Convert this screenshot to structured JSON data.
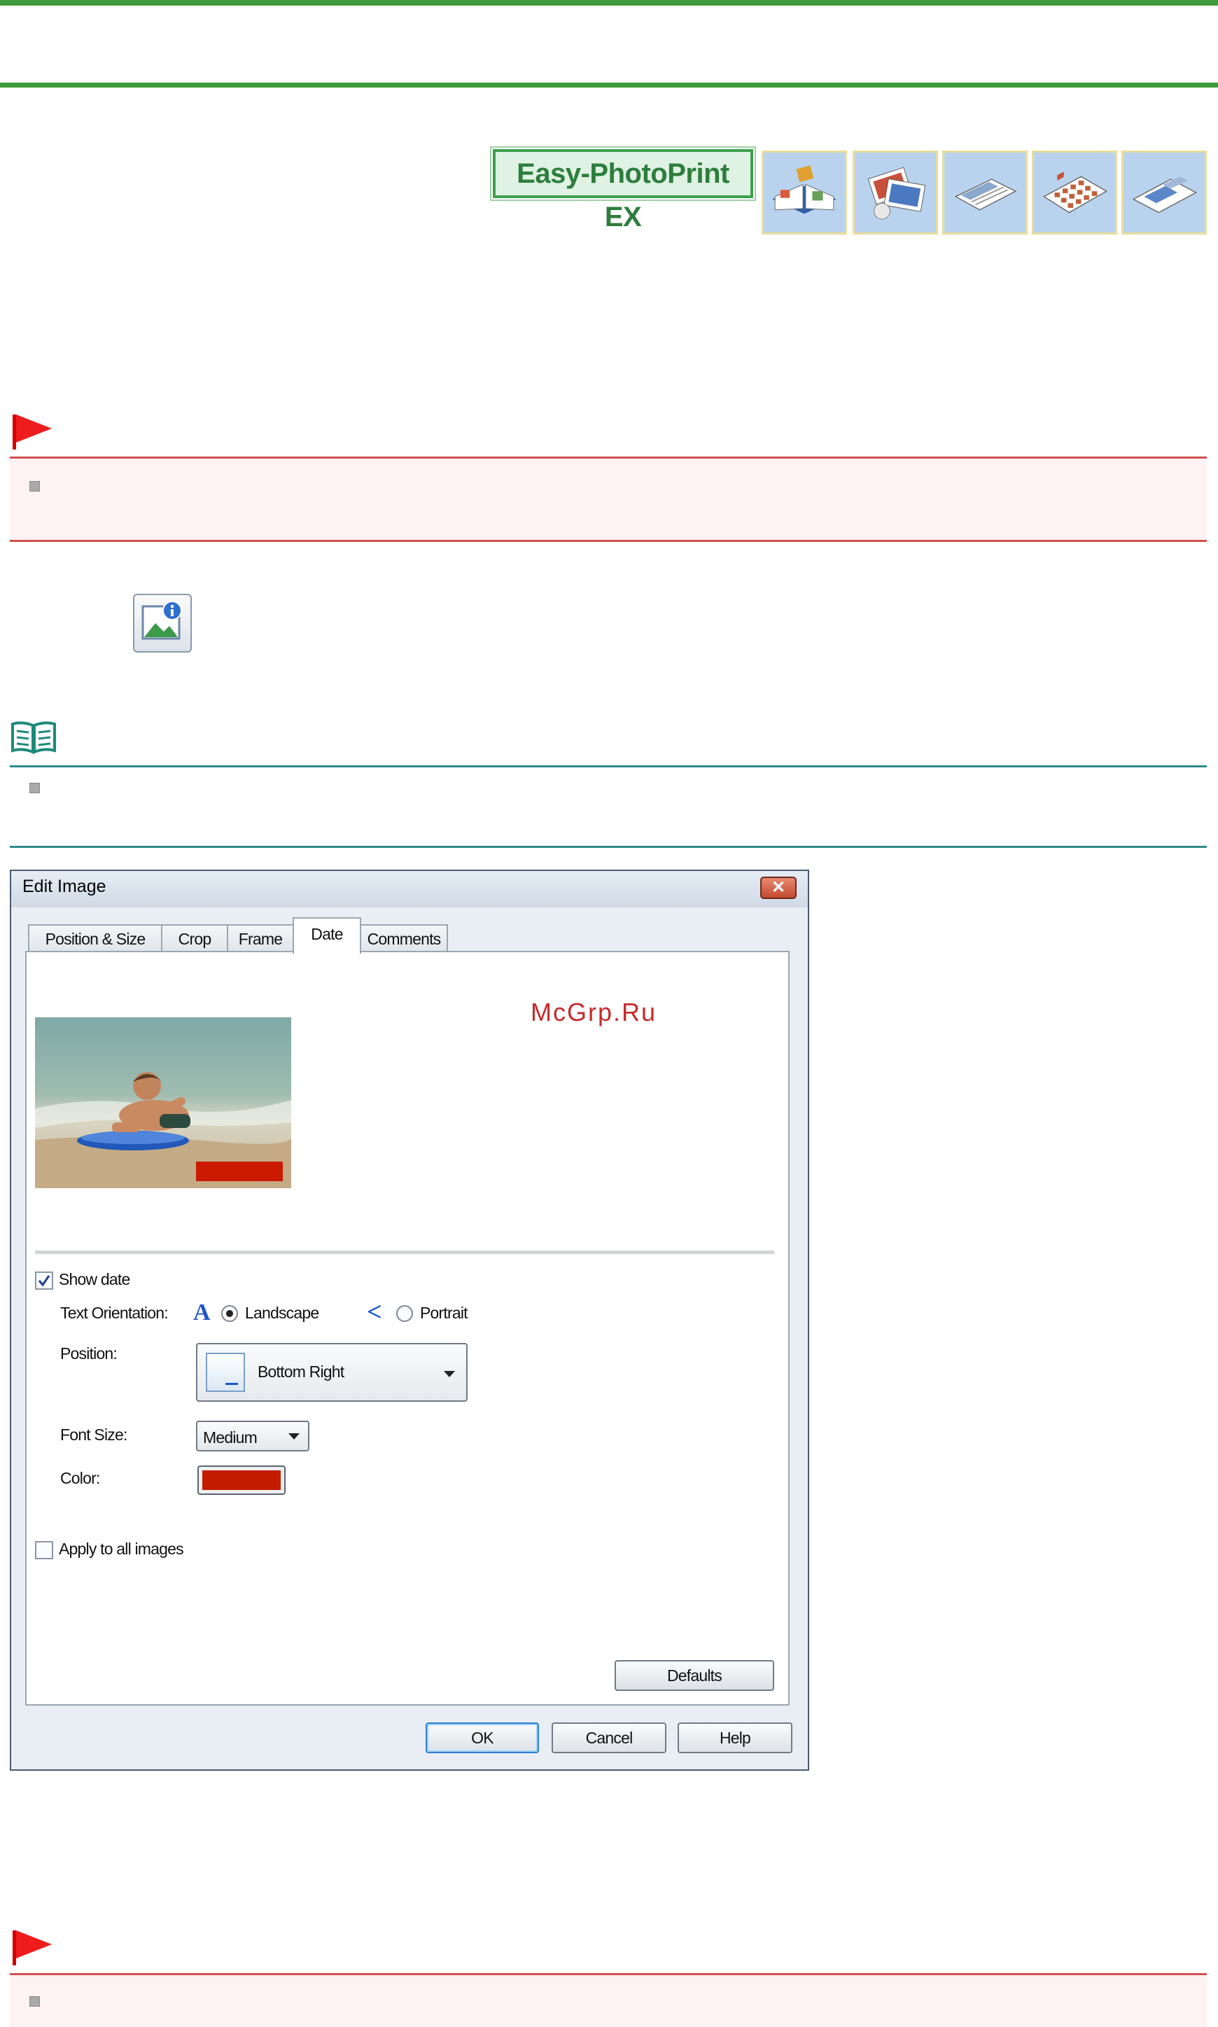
{
  "product": {
    "logo_text": "Easy-PhotoPrint EX"
  },
  "watermark": "McGrp.Ru",
  "dialog": {
    "title": "Edit Image",
    "close_symbol": "✕",
    "tabs": [
      {
        "label": "Position & Size"
      },
      {
        "label": "Crop"
      },
      {
        "label": "Frame"
      },
      {
        "label": "Date"
      },
      {
        "label": "Comments"
      }
    ],
    "active_tab": "Date",
    "show_date": {
      "label": "Show date",
      "checked": true
    },
    "text_orientation": {
      "label": "Text Orientation:",
      "landscape_label": "Landscape",
      "portrait_label": "Portrait",
      "landscape_glyph": "A",
      "portrait_glyph": "<",
      "selected": "Landscape"
    },
    "position": {
      "label": "Position:",
      "value": "Bottom Right"
    },
    "font_size": {
      "label": "Font Size:",
      "value": "Medium"
    },
    "color": {
      "label": "Color:",
      "value": "#c41c00"
    },
    "apply_all": {
      "label": "Apply to all images",
      "checked": false
    },
    "defaults_button": "Defaults",
    "ok_button": "OK",
    "cancel_button": "Cancel",
    "help_button": "Help"
  },
  "colors": {
    "accent_green": "#3e9a3a",
    "caution_red": "#d05050",
    "note_teal": "#2f8a8a",
    "date_stamp": "#cc1a00"
  },
  "icons": [
    "flag-icon",
    "book-icon",
    "image-info-icon",
    "close-icon",
    "checkmark-icon",
    "chevron-down-icon"
  ]
}
